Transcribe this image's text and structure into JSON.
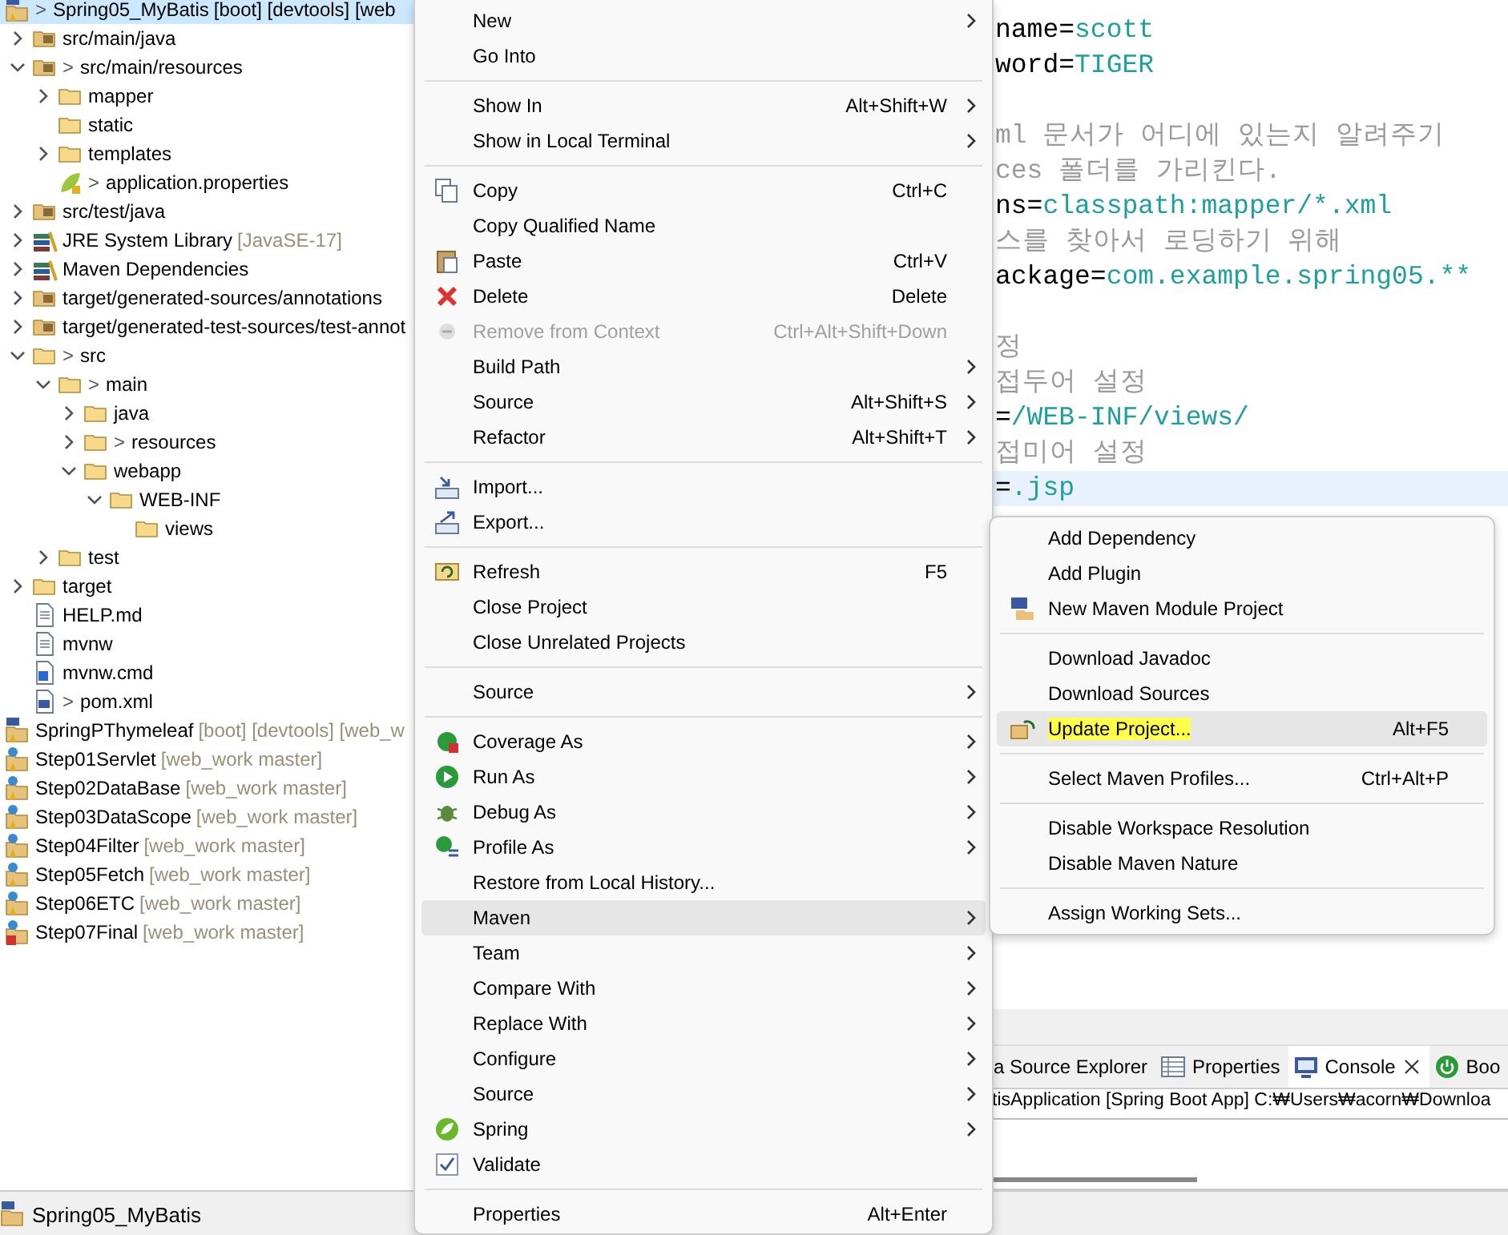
{
  "project_explorer": {
    "projects": [
      {
        "label": "Spring05_MyBatis",
        "decorator": ">",
        "detail": "[boot] [devtools] [web",
        "kind": "maven-project",
        "selected": true,
        "children": [
          {
            "label": "src/main/java",
            "kind": "source-folder",
            "expanded": false,
            "selected": false
          },
          {
            "label": "src/main/resources",
            "decorator": ">",
            "kind": "source-folder",
            "expanded": true,
            "selected": false,
            "children": [
              {
                "label": "mapper",
                "kind": "folder",
                "expanded": false,
                "selected": false
              },
              {
                "label": "static",
                "kind": "folder",
                "selected": false
              },
              {
                "label": "templates",
                "kind": "folder",
                "expanded": false,
                "selected": false
              },
              {
                "label": "application.properties",
                "decorator": ">",
                "kind": "properties",
                "selected": false
              }
            ]
          },
          {
            "label": "src/test/java",
            "kind": "source-folder",
            "expanded": false,
            "selected": false
          },
          {
            "label": "JRE System Library",
            "detail": "[JavaSE-17]",
            "kind": "library",
            "expanded": false,
            "selected": false
          },
          {
            "label": "Maven Dependencies",
            "kind": "library",
            "expanded": false,
            "selected": false
          },
          {
            "label": "target/generated-sources/annotations",
            "kind": "source-folder",
            "expanded": false,
            "selected": false
          },
          {
            "label": "target/generated-test-sources/test-annot",
            "kind": "source-folder",
            "expanded": false,
            "selected": false
          },
          {
            "label": "src",
            "decorator": ">",
            "kind": "folder",
            "expanded": true,
            "selected": false,
            "children": [
              {
                "label": "main",
                "decorator": ">",
                "kind": "folder",
                "expanded": true,
                "selected": false,
                "children": [
                  {
                    "label": "java",
                    "kind": "folder",
                    "expanded": false,
                    "selected": false
                  },
                  {
                    "label": "resources",
                    "decorator": ">",
                    "kind": "folder",
                    "expanded": false,
                    "selected": false
                  },
                  {
                    "label": "webapp",
                    "kind": "folder",
                    "expanded": true,
                    "selected": false,
                    "children": [
                      {
                        "label": "WEB-INF",
                        "kind": "folder",
                        "expanded": true,
                        "selected": false,
                        "children": [
                          {
                            "label": "views",
                            "kind": "folder",
                            "selected": false
                          }
                        ]
                      }
                    ]
                  }
                ]
              },
              {
                "label": "test",
                "kind": "folder",
                "expanded": false,
                "selected": false
              }
            ]
          },
          {
            "label": "target",
            "kind": "folder",
            "expanded": false,
            "selected": false
          },
          {
            "label": "HELP.md",
            "kind": "doc-file",
            "selected": false
          },
          {
            "label": "mvnw",
            "kind": "text-file",
            "selected": false
          },
          {
            "label": "mvnw.cmd",
            "kind": "cmd-file",
            "selected": false
          },
          {
            "label": "pom.xml",
            "decorator": ">",
            "kind": "pom-file",
            "selected": false
          }
        ]
      },
      {
        "label": "SpringPThymeleaf",
        "detail": "[boot] [devtools] [web_w",
        "kind": "maven-project",
        "selected": false
      },
      {
        "label": "Step01Servlet",
        "detail": "[web_work master]",
        "kind": "web-project",
        "selected": false
      },
      {
        "label": "Step02DataBase",
        "detail": "[web_work master]",
        "kind": "web-project",
        "selected": false
      },
      {
        "label": "Step03DataScope",
        "detail": "[web_work master]",
        "kind": "web-project",
        "selected": false
      },
      {
        "label": "Step04Filter",
        "detail": "[web_work master]",
        "kind": "web-project",
        "selected": false
      },
      {
        "label": "Step05Fetch",
        "detail": "[web_work master]",
        "kind": "web-project",
        "selected": false
      },
      {
        "label": "Step06ETC",
        "detail": "[web_work master]",
        "kind": "web-project",
        "selected": false
      },
      {
        "label": "Step07Final",
        "detail": "[web_work master]",
        "kind": "error-project",
        "selected": false
      }
    ]
  },
  "editor": {
    "lines": [
      {
        "kind": "kv",
        "key": "name=",
        "value": "scott",
        "current": false
      },
      {
        "kind": "kv",
        "key": "word=",
        "value": "TIGER",
        "current": false
      },
      {
        "kind": "blank",
        "current": false
      },
      {
        "kind": "comment",
        "text": "ml 문서가 어디에 있는지 알려주기",
        "current": false
      },
      {
        "kind": "comment",
        "text": "ces 폴더를 가리킨다.",
        "current": false
      },
      {
        "kind": "kv",
        "key": "ns=",
        "value": "classpath:mapper/*.xml",
        "current": false
      },
      {
        "kind": "comment",
        "text": "스를 찾아서 로딩하기 위해",
        "current": false
      },
      {
        "kind": "kv",
        "key": "ackage=",
        "value": "com.example.spring05.**",
        "current": false
      },
      {
        "kind": "blank",
        "current": false
      },
      {
        "kind": "comment",
        "text": "정",
        "current": false
      },
      {
        "kind": "comment",
        "text": "접두어 설정",
        "current": false
      },
      {
        "kind": "kv",
        "key": "=",
        "value": "/WEB-INF/views/",
        "current": false
      },
      {
        "kind": "comment",
        "text": "접미어 설정",
        "current": false
      },
      {
        "kind": "kv",
        "key": "=",
        "value": ".jsp",
        "current": true
      }
    ]
  },
  "bottom_panel": {
    "tabs": [
      {
        "label": "a Source Explorer",
        "kind": "plain",
        "closable": false,
        "selected": false
      },
      {
        "label": "Properties",
        "kind": "table",
        "closable": false,
        "selected": false
      },
      {
        "label": "Console",
        "kind": "monitor",
        "closable": true,
        "selected": true
      },
      {
        "label": "Boo",
        "kind": "spring-boot",
        "closable": false,
        "selected": false
      }
    ],
    "console_line": "tisApplication [Spring Boot App] C:₩Users₩acorn₩Downloa"
  },
  "status_bar": {
    "text": "Spring05_MyBatis"
  },
  "context_menu": {
    "items": [
      {
        "kind": "plain",
        "label": "New",
        "submenu": true,
        "disabled": false,
        "selected": false
      },
      {
        "kind": "plain",
        "label": "Go Into",
        "submenu": false,
        "disabled": false,
        "selected": false
      },
      {
        "kind": "separator"
      },
      {
        "kind": "plain",
        "label": "Show In",
        "shortcut": "Alt+Shift+W",
        "submenu": true,
        "disabled": false,
        "selected": false
      },
      {
        "kind": "plain",
        "label": "Show in Local Terminal",
        "submenu": true,
        "disabled": false,
        "selected": false
      },
      {
        "kind": "separator"
      },
      {
        "kind": "copy",
        "label": "Copy",
        "shortcut": "Ctrl+C",
        "submenu": false,
        "disabled": false,
        "selected": false
      },
      {
        "kind": "plain",
        "label": "Copy Qualified Name",
        "submenu": false,
        "disabled": false,
        "selected": false
      },
      {
        "kind": "paste",
        "label": "Paste",
        "shortcut": "Ctrl+V",
        "submenu": false,
        "disabled": false,
        "selected": false
      },
      {
        "kind": "delete",
        "label": "Delete",
        "shortcut": "Delete",
        "submenu": false,
        "disabled": false,
        "selected": false
      },
      {
        "kind": "remove",
        "label": "Remove from Context",
        "shortcut": "Ctrl+Alt+Shift+Down",
        "submenu": false,
        "disabled": true,
        "selected": false
      },
      {
        "kind": "plain",
        "label": "Build Path",
        "submenu": true,
        "disabled": false,
        "selected": false
      },
      {
        "kind": "plain",
        "label": "Source",
        "shortcut": "Alt+Shift+S",
        "submenu": true,
        "disabled": false,
        "selected": false
      },
      {
        "kind": "plain",
        "label": "Refactor",
        "shortcut": "Alt+Shift+T",
        "submenu": true,
        "disabled": false,
        "selected": false
      },
      {
        "kind": "separator"
      },
      {
        "kind": "import",
        "label": "Import...",
        "submenu": false,
        "disabled": false,
        "selected": false
      },
      {
        "kind": "export",
        "label": "Export...",
        "submenu": false,
        "disabled": false,
        "selected": false
      },
      {
        "kind": "separator"
      },
      {
        "kind": "refresh",
        "label": "Refresh",
        "shortcut": "F5",
        "submenu": false,
        "disabled": false,
        "selected": false
      },
      {
        "kind": "plain",
        "label": "Close Project",
        "submenu": false,
        "disabled": false,
        "selected": false
      },
      {
        "kind": "plain",
        "label": "Close Unrelated Projects",
        "submenu": false,
        "disabled": false,
        "selected": false
      },
      {
        "kind": "separator"
      },
      {
        "kind": "plain",
        "label": "Source",
        "submenu": true,
        "disabled": false,
        "selected": false
      },
      {
        "kind": "separator"
      },
      {
        "kind": "coverage",
        "label": "Coverage As",
        "submenu": true,
        "disabled": false,
        "selected": false
      },
      {
        "kind": "run",
        "label": "Run As",
        "submenu": true,
        "disabled": false,
        "selected": false
      },
      {
        "kind": "debug",
        "label": "Debug As",
        "submenu": true,
        "disabled": false,
        "selected": false
      },
      {
        "kind": "profile",
        "label": "Profile As",
        "submenu": true,
        "disabled": false,
        "selected": false
      },
      {
        "kind": "plain",
        "label": "Restore from Local History...",
        "submenu": false,
        "disabled": false,
        "selected": false
      },
      {
        "kind": "plain",
        "label": "Maven",
        "submenu": true,
        "disabled": false,
        "selected": true
      },
      {
        "kind": "plain",
        "label": "Team",
        "submenu": true,
        "disabled": false,
        "selected": false
      },
      {
        "kind": "plain",
        "label": "Compare With",
        "submenu": true,
        "disabled": false,
        "selected": false
      },
      {
        "kind": "plain",
        "label": "Replace With",
        "submenu": true,
        "disabled": false,
        "selected": false
      },
      {
        "kind": "plain",
        "label": "Configure",
        "submenu": true,
        "disabled": false,
        "selected": false
      },
      {
        "kind": "plain",
        "label": "Source",
        "submenu": true,
        "disabled": false,
        "selected": false
      },
      {
        "kind": "spring",
        "label": "Spring",
        "submenu": true,
        "disabled": false,
        "selected": false
      },
      {
        "kind": "check",
        "label": "Validate",
        "submenu": false,
        "disabled": false,
        "selected": false
      },
      {
        "kind": "separator"
      },
      {
        "kind": "plain",
        "label": "Properties",
        "shortcut": "Alt+Enter",
        "submenu": false,
        "disabled": false,
        "selected": false
      }
    ]
  },
  "maven_submenu": {
    "items": [
      {
        "kind": "plain",
        "label": "Add Dependency",
        "selected": false,
        "highlighted": false
      },
      {
        "kind": "plain",
        "label": "Add Plugin",
        "selected": false,
        "highlighted": false
      },
      {
        "kind": "maven-module",
        "label": "New Maven Module Project",
        "selected": false,
        "highlighted": false
      },
      {
        "kind": "separator"
      },
      {
        "kind": "plain",
        "label": "Download Javadoc",
        "selected": false,
        "highlighted": false
      },
      {
        "kind": "plain",
        "label": "Download Sources",
        "selected": false,
        "highlighted": false
      },
      {
        "kind": "update",
        "label": "Update Project...",
        "shortcut": "Alt+F5",
        "selected": true,
        "highlighted": true
      },
      {
        "kind": "separator"
      },
      {
        "kind": "plain",
        "label": "Select Maven Profiles...",
        "shortcut": "Ctrl+Alt+P",
        "selected": false,
        "highlighted": false
      },
      {
        "kind": "separator"
      },
      {
        "kind": "plain",
        "label": "Disable Workspace Resolution",
        "selected": false,
        "highlighted": false
      },
      {
        "kind": "plain",
        "label": "Disable Maven Nature",
        "selected": false,
        "highlighted": false
      },
      {
        "kind": "separator"
      },
      {
        "kind": "plain",
        "label": "Assign Working Sets...",
        "selected": false,
        "highlighted": false
      }
    ]
  }
}
